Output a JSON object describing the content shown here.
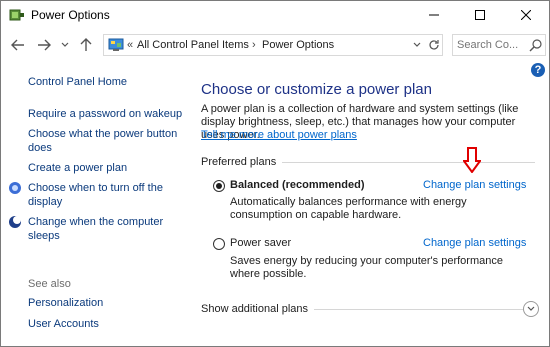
{
  "window": {
    "title": "Power Options",
    "minimize_icon": "minimize-icon",
    "maximize_icon": "maximize-icon",
    "close_icon": "close-icon"
  },
  "nav": {
    "back_icon": "back-arrow-icon",
    "forward_icon": "forward-arrow-icon",
    "recent_icon": "chevron-down-icon",
    "up_icon": "up-arrow-icon",
    "breadcrumb_prefix": "«",
    "breadcrumbs": [
      "All Control Panel Items",
      "Power Options"
    ],
    "breadcrumb_separator": "›",
    "search_placeholder": "Search Co..."
  },
  "sidebar": {
    "home": "Control Panel Home",
    "links": [
      "Require a password on wakeup",
      "Choose what the power button does",
      "Create a power plan",
      "Choose when to turn off the display",
      "Change when the computer sleeps"
    ],
    "see_also_label": "See also",
    "see_also_links": [
      "Personalization",
      "User Accounts"
    ]
  },
  "main": {
    "heading": "Choose or customize a power plan",
    "description": "A power plan is a collection of hardware and system settings (like display brightness, sleep, etc.) that manages how your computer uses power.",
    "tell_more": "Tell me more about power plans",
    "preferred_label": "Preferred plans",
    "plans": [
      {
        "name": "Balanced (recommended)",
        "selected": true,
        "description": "Automatically balances performance with energy consumption on capable hardware.",
        "change_link": "Change plan settings"
      },
      {
        "name": "Power saver",
        "selected": false,
        "description": "Saves energy by reducing your computer's performance where possible.",
        "change_link": "Change plan settings"
      }
    ],
    "additional_label": "Show additional plans"
  },
  "colors": {
    "heading": "#1e3287",
    "link": "#0066cc",
    "sidebar_link": "#0b3a7c",
    "annotation_arrow": "#e00000"
  }
}
